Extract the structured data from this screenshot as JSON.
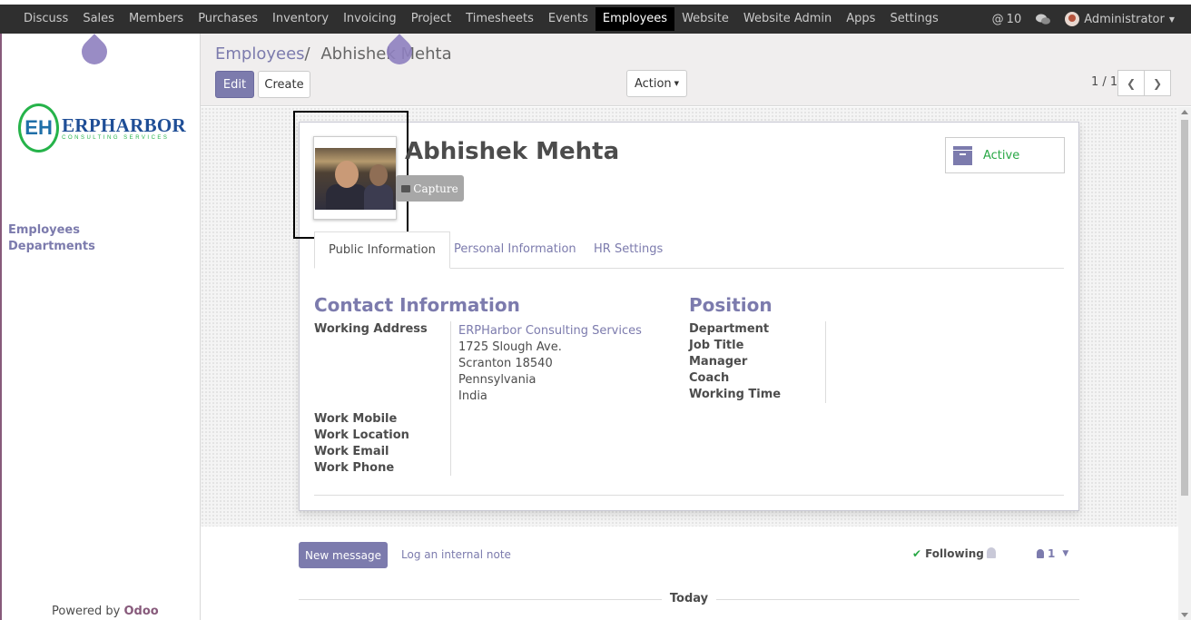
{
  "topbar": {
    "menu": [
      "Discuss",
      "Sales",
      "Members",
      "Purchases",
      "Inventory",
      "Invoicing",
      "Project",
      "Timesheets",
      "Events",
      "Employees",
      "Website",
      "Website Admin",
      "Apps",
      "Settings"
    ],
    "active": "Employees",
    "mentions_count": "10",
    "user": "Administrator"
  },
  "sidebar": {
    "logo_main": "ERPHARBOR",
    "logo_sub": "CONSULTING SERVICES",
    "logo_mark": "EH",
    "links": [
      "Employees",
      "Departments"
    ],
    "powered_by": "Powered by",
    "powered_brand": "Odoo"
  },
  "control": {
    "breadcrumb_parent": "Employees",
    "breadcrumb_sep": "/",
    "breadcrumb_current": "Abhishek Mehta",
    "edit_label": "Edit",
    "create_label": "Create",
    "action_label": "Action",
    "pager": "1 / 1"
  },
  "employee": {
    "name": "Abhishek Mehta",
    "capture_label": "Capture",
    "status_label": "Active",
    "tabs": [
      "Public Information",
      "Personal Information",
      "HR Settings"
    ],
    "active_tab": "Public Information"
  },
  "contact": {
    "heading": "Contact Information",
    "working_address_label": "Working Address",
    "address_company": "ERPHarbor Consulting Services",
    "address_lines": [
      "1725 Slough Ave.",
      "Scranton 18540",
      "Pennsylvania",
      "India"
    ],
    "work_mobile_label": "Work Mobile",
    "work_location_label": "Work Location",
    "work_email_label": "Work Email",
    "work_phone_label": "Work Phone"
  },
  "position": {
    "heading": "Position",
    "labels": [
      "Department",
      "Job Title",
      "Manager",
      "Coach",
      "Working Time"
    ]
  },
  "chatter": {
    "new_message": "New message",
    "log_note": "Log an internal note",
    "following": "Following",
    "followers_count": "1",
    "today": "Today"
  },
  "colors": {
    "accent": "#7c7bad",
    "brand": "#875a7b",
    "navbar": "#2f2f2f",
    "status": "#28a745"
  }
}
